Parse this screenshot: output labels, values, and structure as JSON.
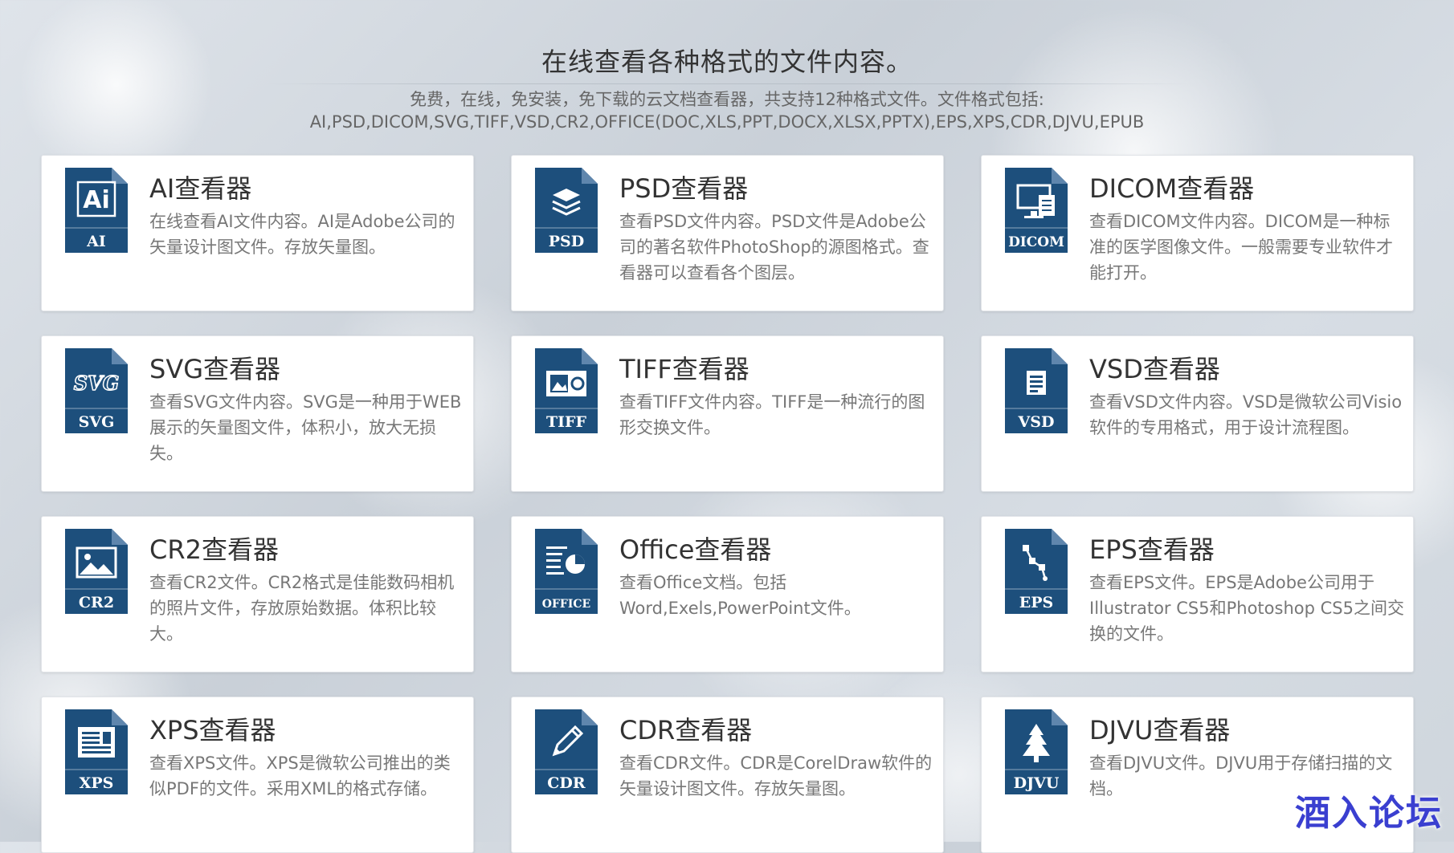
{
  "header": {
    "title": "在线查看各种格式的文件内容。",
    "subtitle_line1": "免费，在线，免安装，免下载的云文档查看器，共支持12种格式文件。文件格式包括:",
    "subtitle_line2": "AI,PSD,DICOM,SVG,TIFF,VSD,CR2,OFFICE(DOC,XLS,PPT,DOCX,XLSX,PPTX),EPS,XPS,CDR,DJVU,EPUB"
  },
  "colors": {
    "icon": "#1d4f7c",
    "card_bg": "#ffffff",
    "title_text": "#333333",
    "desc_text": "#777777",
    "watermark": "#3a3fd0"
  },
  "viewers": [
    {
      "id": "ai",
      "title": "AI查看器",
      "desc": "在线查看AI文件内容。AI是Adobe公司的矢量设计图文件。存放矢量图。",
      "icon_label": "AI",
      "icon": "ai-glyph-icon"
    },
    {
      "id": "psd",
      "title": "PSD查看器",
      "desc": "查看PSD文件内容。PSD文件是Adobe公司的著名软件PhotoShop的源图格式。查看器可以查看各个图层。",
      "icon_label": "PSD",
      "icon": "layers-icon"
    },
    {
      "id": "dicom",
      "title": "DICOM查看器",
      "desc": "查看DICOM文件内容。DICOM是一种标准的医学图像文件。一般需要专业软件才能打开。",
      "icon_label": "DICOM",
      "icon": "monitor-icon"
    },
    {
      "id": "svg",
      "title": "SVG查看器",
      "desc": "查看SVG文件内容。SVG是一种用于WEB展示的矢量图文件，体积小，放大无损失。",
      "icon_label": "SVG",
      "icon": "svg-glyph-icon"
    },
    {
      "id": "tiff",
      "title": "TIFF查看器",
      "desc": "查看TIFF文件内容。TIFF是一种流行的图形交换文件。",
      "icon_label": "TIFF",
      "icon": "photo-frame-icon"
    },
    {
      "id": "vsd",
      "title": "VSD查看器",
      "desc": "查看VSD文件内容。VSD是微软公司Visio软件的专用格式，用于设计流程图。",
      "icon_label": "VSD",
      "icon": "document-icon"
    },
    {
      "id": "cr2",
      "title": "CR2查看器",
      "desc": "查看CR2文件。CR2格式是佳能数码相机的照片文件，存放原始数据。体积比较大。",
      "icon_label": "CR2",
      "icon": "image-icon"
    },
    {
      "id": "office",
      "title": "Office查看器",
      "desc": "查看Office文档。包括Word,Exels,PowerPoint文件。",
      "icon_label": "OFFICE",
      "icon": "pie-chart-icon"
    },
    {
      "id": "eps",
      "title": "EPS查看器",
      "desc": "查看EPS文件。EPS是Adobe公司用于Illustrator CS5和Photoshop CS5之间交换的文件。",
      "icon_label": "EPS",
      "icon": "vector-path-icon"
    },
    {
      "id": "xps",
      "title": "XPS查看器",
      "desc": "查看XPS文件。XPS是微软公司推出的类似PDF的文件。采用XML的格式存储。",
      "icon_label": "XPS",
      "icon": "text-document-icon"
    },
    {
      "id": "cdr",
      "title": "CDR查看器",
      "desc": "查看CDR文件。CDR是CorelDraw软件的矢量设计图文件。存放矢量图。",
      "icon_label": "CDR",
      "icon": "pencil-icon"
    },
    {
      "id": "djvu",
      "title": "DJVU查看器",
      "desc": "查看DJVU文件。DJVU用于存储扫描的文档。",
      "icon_label": "DJVU",
      "icon": "tree-icon"
    }
  ],
  "watermark": {
    "text": "酒入论坛"
  }
}
